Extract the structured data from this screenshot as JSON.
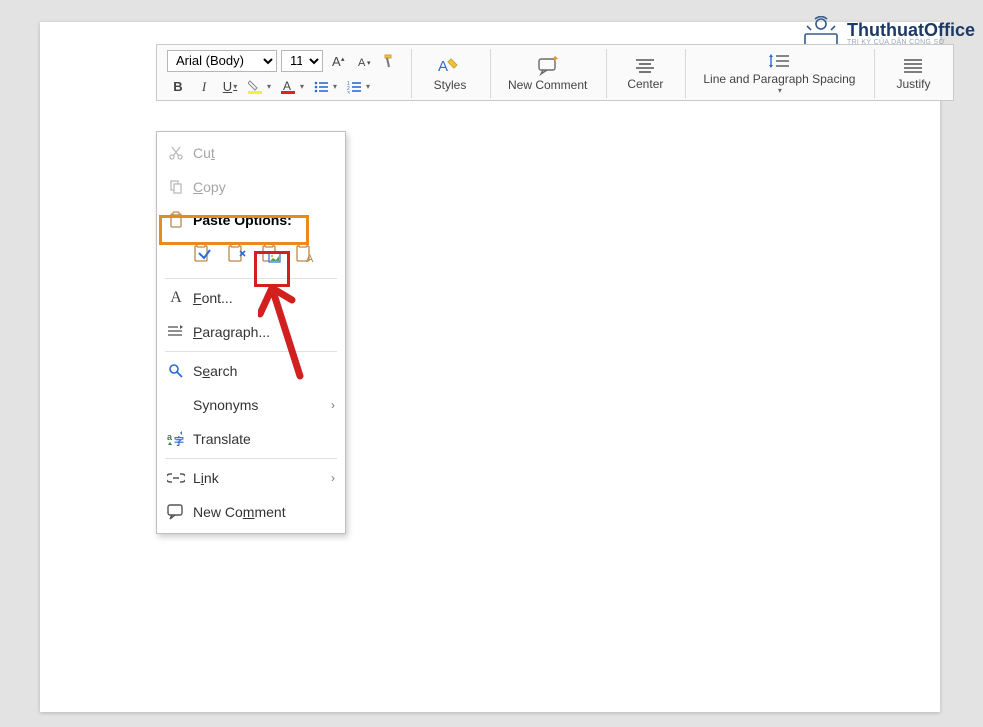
{
  "watermark": {
    "title": "ThuthuatOffice",
    "sub": "TRI KỶ CỦA DÂN CÔNG SỞ"
  },
  "toolbar": {
    "font_name": "Arial (Body)",
    "font_size": "11",
    "styles_label": "Styles",
    "new_comment_label": "New Comment",
    "center_label": "Center",
    "spacing_label": "Line and Paragraph Spacing",
    "justify_label": "Justify"
  },
  "menu": {
    "cut": "Cut",
    "copy": "Copy",
    "paste_options": "Paste Options:",
    "font": "Font...",
    "paragraph": "Paragraph...",
    "search": "Search",
    "synonyms": "Synonyms",
    "translate": "Translate",
    "link": "Link",
    "new_comment": "New Comment"
  }
}
